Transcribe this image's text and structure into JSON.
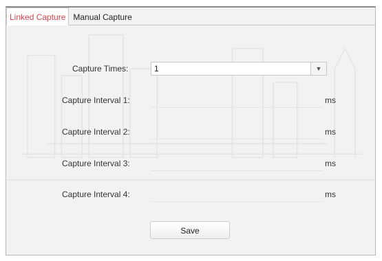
{
  "tabs": [
    {
      "label": "Linked Capture",
      "active": true
    },
    {
      "label": "Manual Capture",
      "active": false
    }
  ],
  "capture_times": {
    "label": "Capture Times:",
    "value": "1"
  },
  "intervals": [
    {
      "label": "Capture Interval 1:",
      "value": "",
      "unit": "ms"
    },
    {
      "label": "Capture Interval 2:",
      "value": "",
      "unit": "ms"
    },
    {
      "label": "Capture Interval 3:",
      "value": "",
      "unit": "ms"
    },
    {
      "label": "Capture Interval 4:",
      "value": "",
      "unit": "ms"
    }
  ],
  "save_label": "Save",
  "colors": {
    "active_tab": "#d9414b",
    "panel_bg": "#f2f2f2"
  },
  "icons": {
    "select_arrow": "chevron-down-icon"
  }
}
